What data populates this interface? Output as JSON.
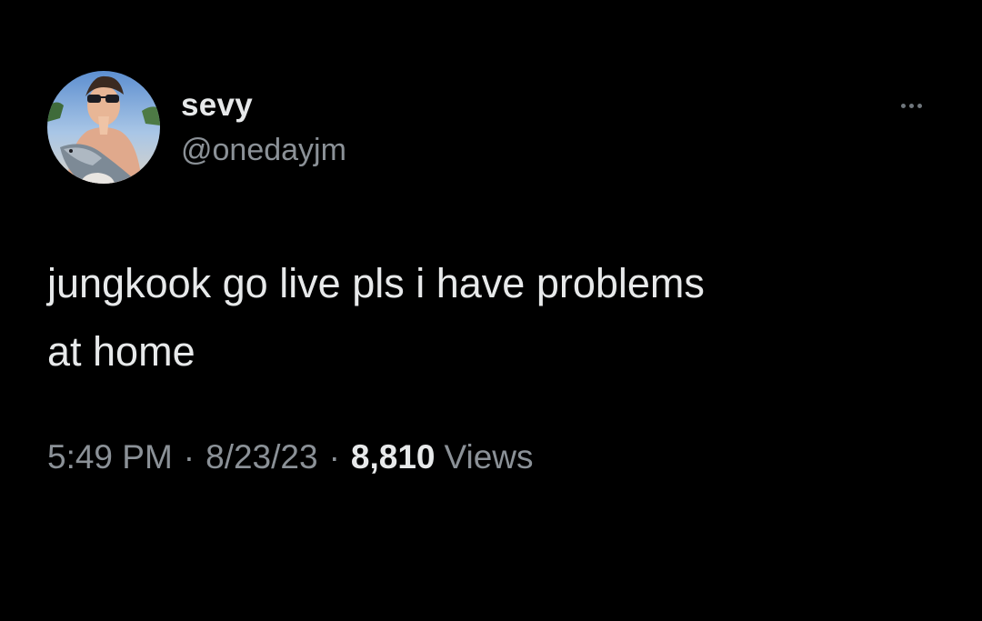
{
  "tweet": {
    "author": {
      "display_name": "sevy",
      "handle": "@onedayjm",
      "avatar_icon": "profile-photo"
    },
    "more_icon": "ellipsis-icon",
    "text": "jungkook go live pls i have problems\nat home",
    "meta": {
      "time": "5:49 PM",
      "separator": "·",
      "date": "8/23/23",
      "views_count": "8,810",
      "views_label": "Views"
    }
  },
  "colors": {
    "background": "#000000",
    "primary_text": "#e7e9ea",
    "secondary_text": "#8b9197"
  }
}
